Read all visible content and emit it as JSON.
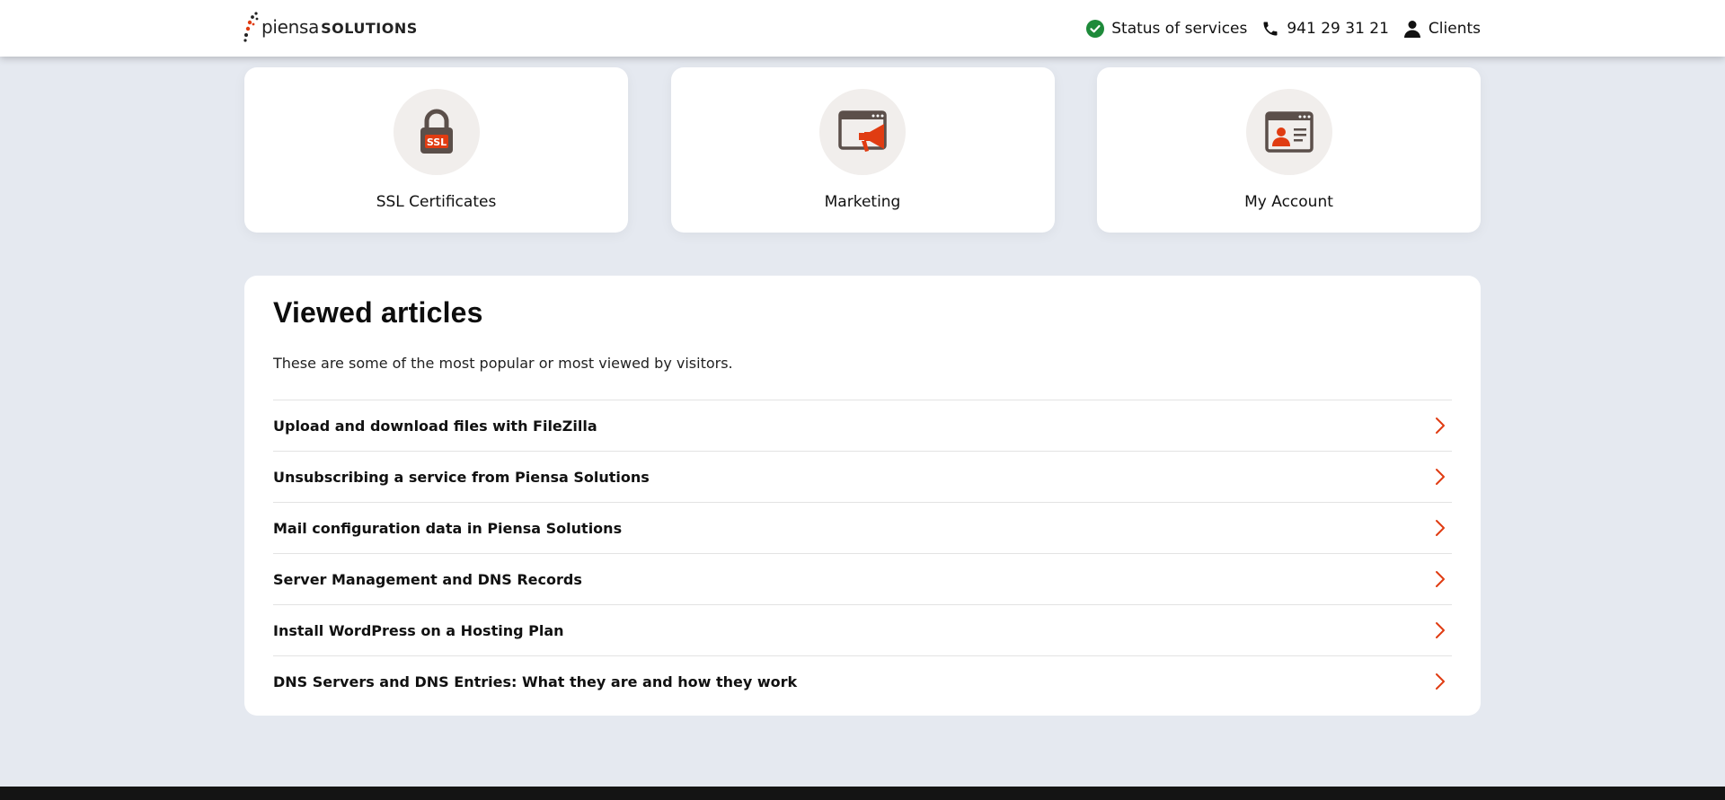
{
  "header": {
    "logo": {
      "word": "piensa",
      "suffix": "SOLUTIONS"
    },
    "status_label": "Status of services",
    "phone": "941 29 31 21",
    "clients_label": "Clients",
    "colors": {
      "status_ok": "#1e8a3a",
      "accent": "#e03c12"
    }
  },
  "cards": [
    {
      "label": "SSL Certificates",
      "icon": "ssl-lock-icon"
    },
    {
      "label": "Marketing",
      "icon": "megaphone-browser-icon"
    },
    {
      "label": "My Account",
      "icon": "profile-card-icon"
    }
  ],
  "articles": {
    "title": "Viewed articles",
    "description": "These are some of the most popular or most viewed by visitors.",
    "items": [
      "Upload and download files with FileZilla",
      "Unsubscribing a service from Piensa Solutions",
      "Mail configuration data in Piensa Solutions",
      "Server Management and DNS Records",
      "Install WordPress on a Hosting Plan",
      "DNS Servers and DNS Entries: What they are and how they work"
    ]
  }
}
